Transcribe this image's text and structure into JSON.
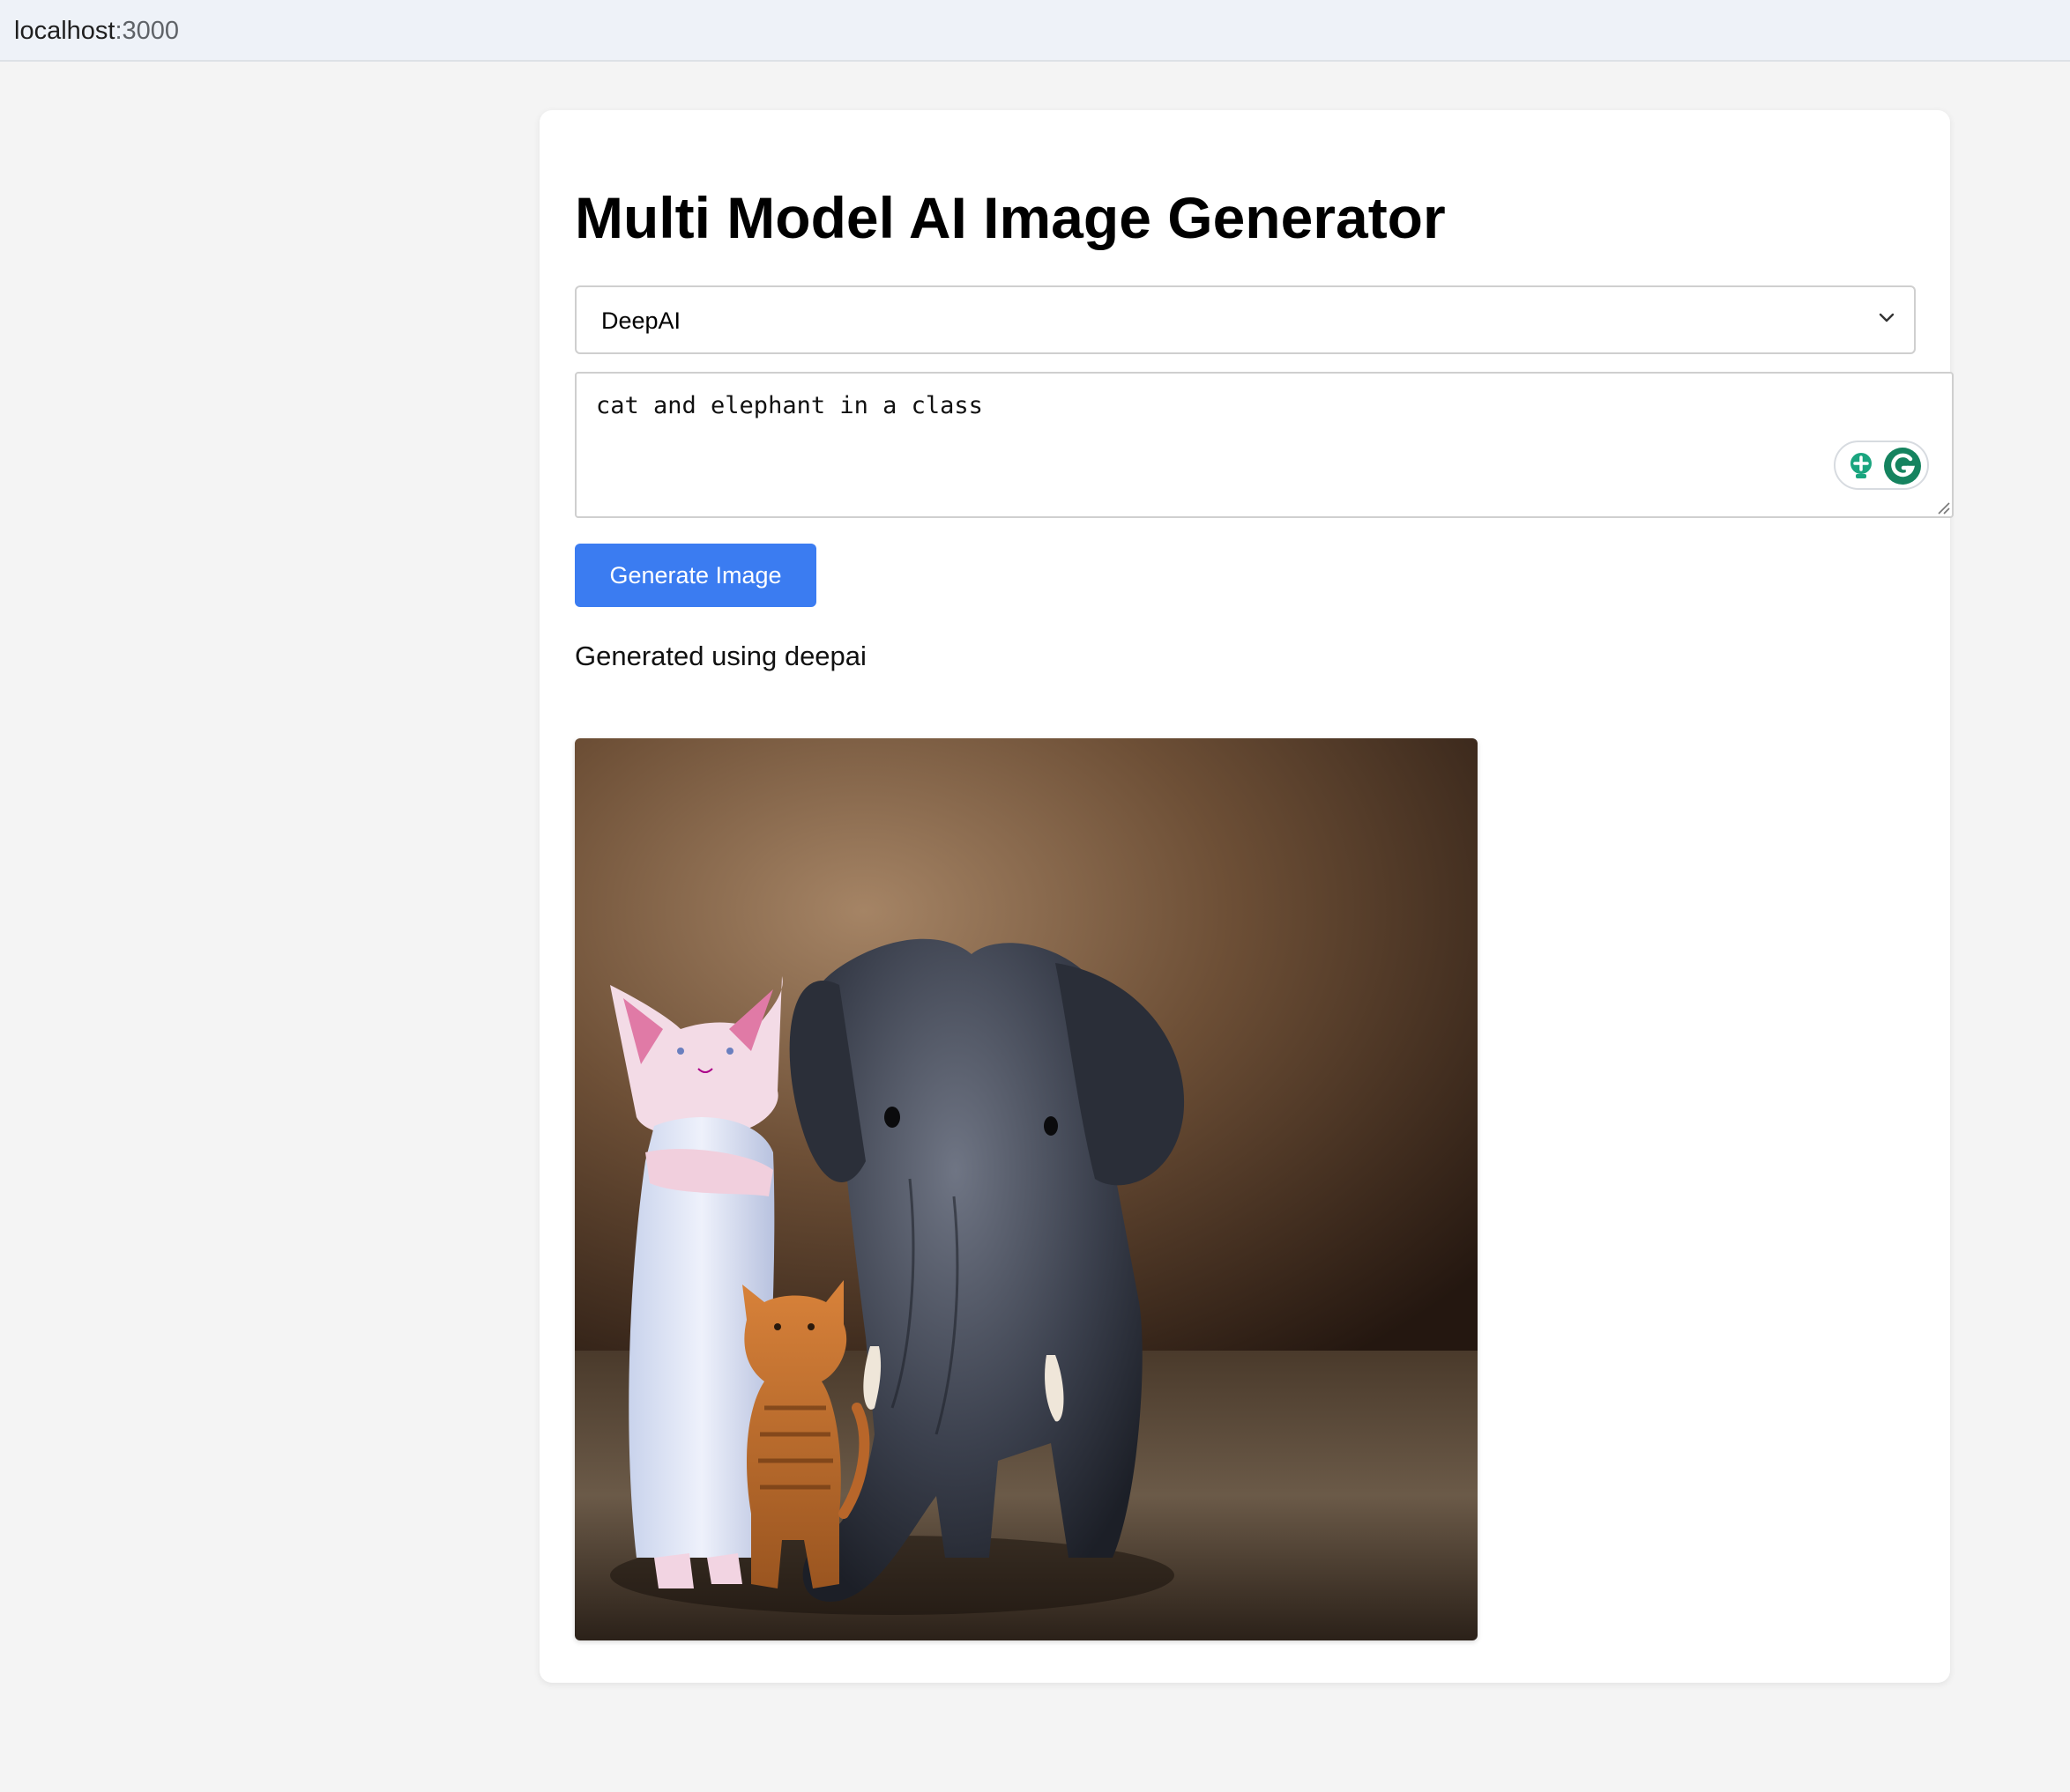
{
  "browser": {
    "url_host": "localhost",
    "url_port": ":3000"
  },
  "app": {
    "title": "Multi Model AI Image Generator",
    "model_select": {
      "selected": "DeepAI"
    },
    "prompt": {
      "value": "cat and elephant in a class"
    },
    "generate_button_label": "Generate Image",
    "result_caption": "Generated using deepai",
    "result_image": {
      "description_icon": "generated-image-cat-and-elephant"
    }
  },
  "colors": {
    "accent": "#3b7cf1",
    "page_bg": "#f4f4f4",
    "card_bg": "#ffffff",
    "grammarly_green": "#15a37e"
  }
}
